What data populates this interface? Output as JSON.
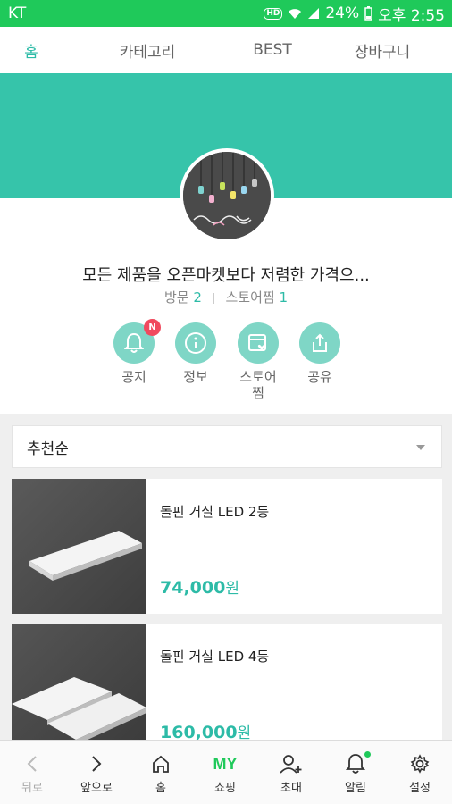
{
  "status_bar": {
    "carrier": "KT",
    "hd": "HD",
    "battery": "24%",
    "time": "오후 2:55"
  },
  "tabs": [
    {
      "label": "홈",
      "active": true
    },
    {
      "label": "카테고리",
      "active": false
    },
    {
      "label": "BEST",
      "active": false
    },
    {
      "label": "장바구니",
      "active": false
    }
  ],
  "store": {
    "name": "모든 제품을 오픈마켓보다 저렴한 가격으...",
    "visits_label": "방문",
    "visits": "2",
    "favorites_label": "스토어찜",
    "favorites": "1"
  },
  "actions": [
    {
      "label": "공지",
      "icon": "bell-icon",
      "badge": "N"
    },
    {
      "label": "정보",
      "icon": "info-icon"
    },
    {
      "label": "스토어\n찜",
      "icon": "store-favorite-icon"
    },
    {
      "label": "공유",
      "icon": "share-icon"
    }
  ],
  "sort": {
    "selected": "추천순"
  },
  "products": [
    {
      "name": "돌핀 거실 LED 2등",
      "price": "74,000",
      "currency": "원"
    },
    {
      "name": "돌핀 거실 LED 4등",
      "price": "160,000",
      "currency": "원"
    }
  ],
  "bottom_nav": [
    {
      "label": "뒤로",
      "icon": "chevron-left-icon",
      "disabled": true
    },
    {
      "label": "앞으로",
      "icon": "chevron-right-icon"
    },
    {
      "label": "홈",
      "icon": "home-icon"
    },
    {
      "label": "쇼핑",
      "icon_text": "MY"
    },
    {
      "label": "초대",
      "icon": "invite-icon"
    },
    {
      "label": "알림",
      "icon": "bell-icon"
    },
    {
      "label": "설정",
      "icon": "gear-icon"
    }
  ],
  "colors": {
    "status_bar": "#1fc95a",
    "accent": "#2dbba7",
    "cover": "#36c4aa",
    "badge": "#f04a5e"
  }
}
